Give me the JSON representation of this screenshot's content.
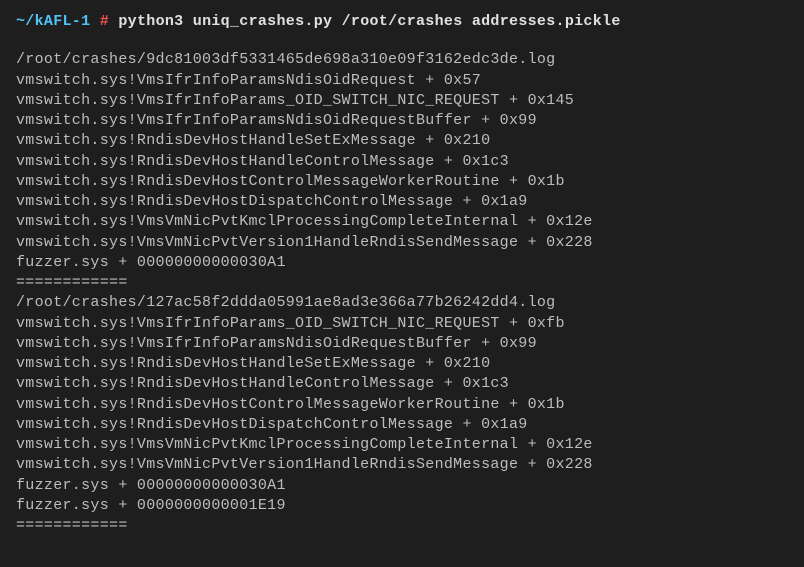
{
  "prompt": {
    "path": "~/kAFL-1",
    "hash": "#",
    "command": "python3 uniq_crashes.py /root/crashes addresses.pickle"
  },
  "blocks": [
    {
      "file": "/root/crashes/9dc81003df5331465de698a310e09f3162edc3de.log",
      "frames": [
        "vmswitch.sys!VmsIfrInfoParamsNdisOidRequest + 0x57",
        "vmswitch.sys!VmsIfrInfoParams_OID_SWITCH_NIC_REQUEST + 0x145",
        "vmswitch.sys!VmsIfrInfoParamsNdisOidRequestBuffer + 0x99",
        "vmswitch.sys!RndisDevHostHandleSetExMessage + 0x210",
        "vmswitch.sys!RndisDevHostHandleControlMessage + 0x1c3",
        "vmswitch.sys!RndisDevHostControlMessageWorkerRoutine + 0x1b",
        "vmswitch.sys!RndisDevHostDispatchControlMessage + 0x1a9",
        "vmswitch.sys!VmsVmNicPvtKmclProcessingCompleteInternal + 0x12e",
        "vmswitch.sys!VmsVmNicPvtVersion1HandleRndisSendMessage + 0x228",
        "fuzzer.sys + 00000000000030A1"
      ],
      "separator": "============"
    },
    {
      "file": "/root/crashes/127ac58f2ddda05991ae8ad3e366a77b26242dd4.log",
      "frames": [
        "vmswitch.sys!VmsIfrInfoParams_OID_SWITCH_NIC_REQUEST + 0xfb",
        "vmswitch.sys!VmsIfrInfoParamsNdisOidRequestBuffer + 0x99",
        "vmswitch.sys!RndisDevHostHandleSetExMessage + 0x210",
        "vmswitch.sys!RndisDevHostHandleControlMessage + 0x1c3",
        "vmswitch.sys!RndisDevHostControlMessageWorkerRoutine + 0x1b",
        "vmswitch.sys!RndisDevHostDispatchControlMessage + 0x1a9",
        "vmswitch.sys!VmsVmNicPvtKmclProcessingCompleteInternal + 0x12e",
        "vmswitch.sys!VmsVmNicPvtVersion1HandleRndisSendMessage + 0x228",
        "fuzzer.sys + 00000000000030A1",
        "fuzzer.sys + 0000000000001E19"
      ],
      "separator": "============"
    }
  ]
}
